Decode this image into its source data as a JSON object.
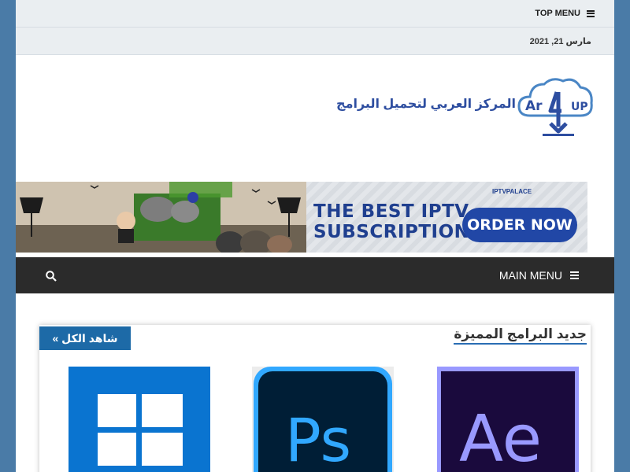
{
  "header": {
    "top_menu_label": "TOP MENU",
    "date": "مارس 21, 2021"
  },
  "logo": {
    "mark": "Ar4UP",
    "site_name": "المركز العربي لتحميل البرامج"
  },
  "banner_ad": {
    "brand": "IPTVPALACE",
    "line1": "THE  BEST IPTV",
    "line2": "SUBSCRIPTION",
    "cta": "ORDER NOW"
  },
  "nav": {
    "main_menu_label": "MAIN MENU"
  },
  "featured": {
    "title": "جديد البرامج المميزة",
    "see_all_label": "شاهد الكل »",
    "items": [
      {
        "name": "Windows",
        "icon": "windows-logo-icon"
      },
      {
        "name": "Ps",
        "icon": "photoshop-logo-icon"
      },
      {
        "name": "Ae",
        "icon": "after-effects-logo-icon"
      }
    ]
  },
  "colors": {
    "page_bg": "#4a7ba7",
    "nav_bg": "#2b2b2b",
    "accent": "#1d6aa7",
    "logo_blue": "#2e4ea0"
  }
}
